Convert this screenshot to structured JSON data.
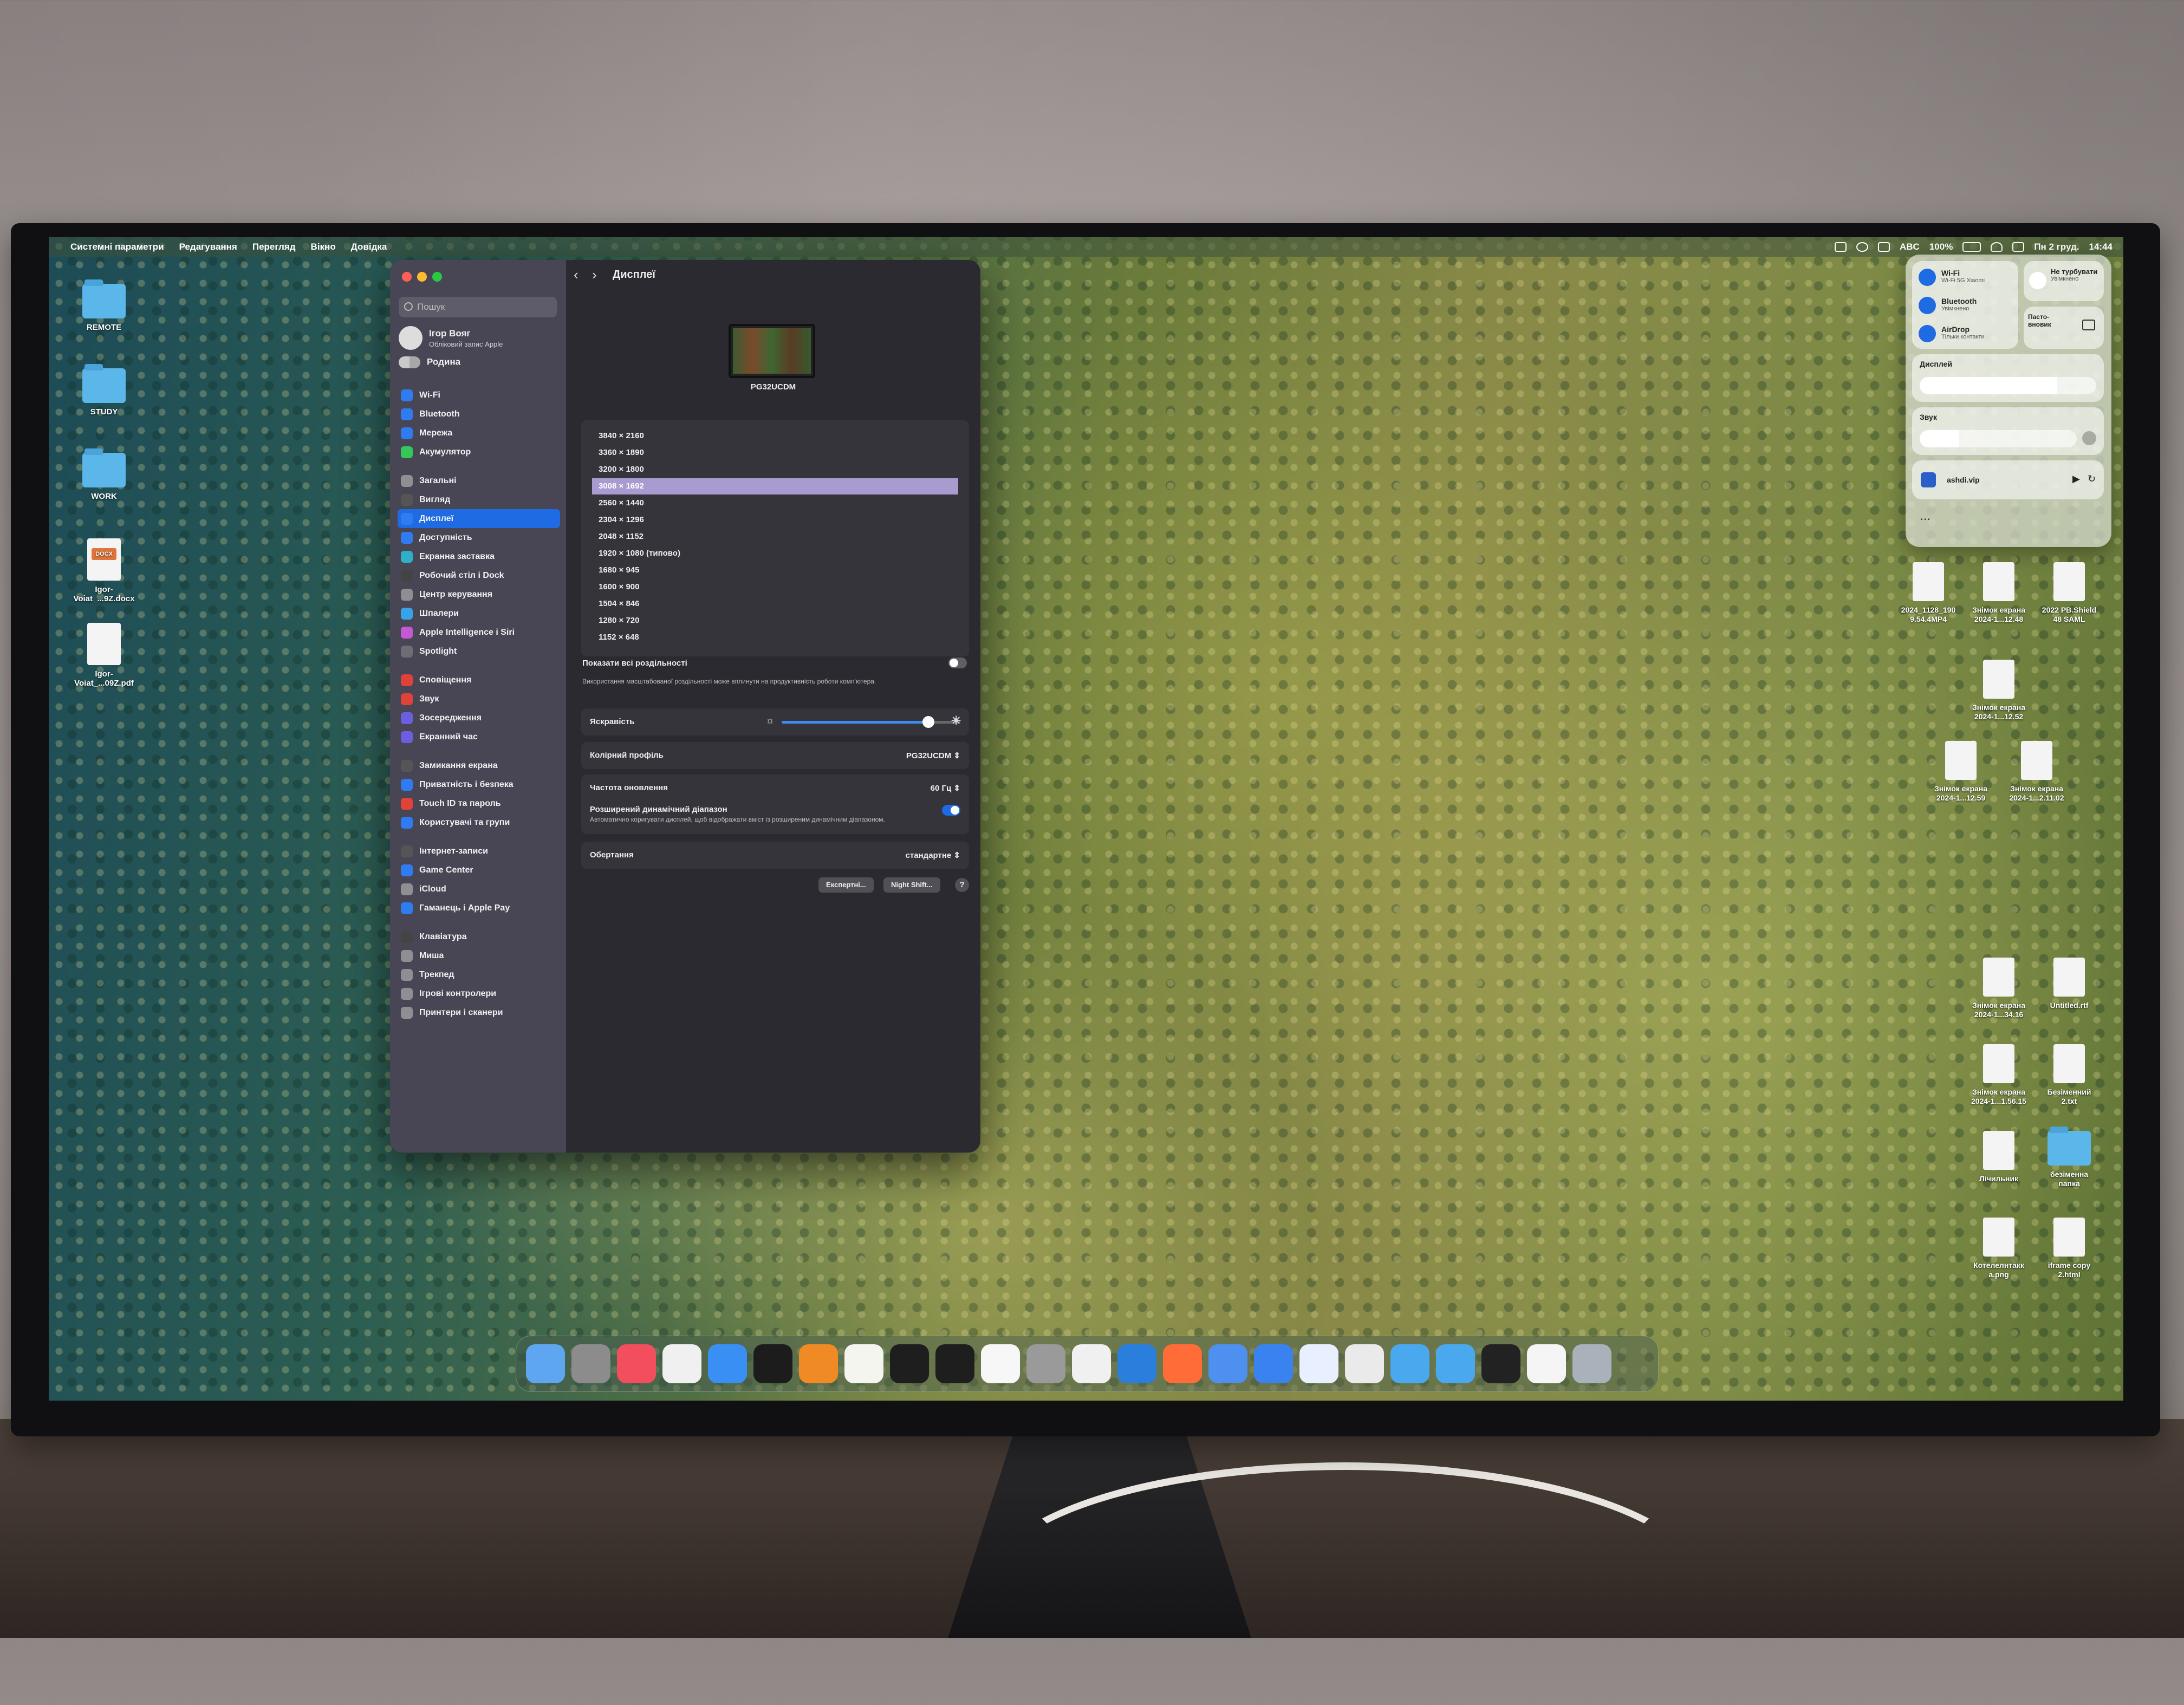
{
  "menubar": {
    "app_name": "Системні параметри",
    "menus": [
      "Редагування",
      "Перегляд",
      "Вікно",
      "Довідка"
    ],
    "right_labels": [
      "ABC",
      "100%",
      "Пн 2 груд.",
      "14:44"
    ]
  },
  "desktop_left": [
    {
      "label": "REMOTE",
      "kind": "folder"
    },
    {
      "label": "STUDY",
      "kind": "folder"
    },
    {
      "label": "WORK",
      "kind": "folder"
    },
    {
      "label": "Igor-Voiat_...9Z.docx",
      "kind": "doc",
      "badge": "DOCX"
    },
    {
      "label": "Igor-Voiat_...09Z.pdf",
      "kind": "doc",
      "badge": ""
    }
  ],
  "settings": {
    "search_placeholder": "Пошук",
    "profile_name": "Ігор Вояг",
    "profile_sub": "Обліковий запис Apple",
    "family": "Родина",
    "sidebar_groups": [
      [
        "Wi-Fi",
        "Bluetooth",
        "Мережа",
        "Акумулятор"
      ],
      [
        "Загальні",
        "Вигляд",
        "Дисплеї",
        "Доступність",
        "Екранна заставка",
        "Робочий стіл і Dock",
        "Центр керування",
        "Шпалери",
        "Apple Intelligence і Siri",
        "Spotlight"
      ],
      [
        "Сповіщення",
        "Звук",
        "Зосередження",
        "Екранний час"
      ],
      [
        "Замикання екрана",
        "Приватність і безпека",
        "Touch ID та пароль",
        "Користувачі та групи"
      ],
      [
        "Інтернет-записи",
        "Game Center",
        "iCloud",
        "Гаманець і Apple Pay"
      ],
      [
        "Клавіатура",
        "Миша",
        "Трекпед",
        "Ігрові контролери",
        "Принтери і сканери"
      ]
    ],
    "selected_item": "Дисплеї",
    "page_title": "Дисплеї",
    "monitor_name": "PG32UCDM",
    "resolutions": [
      "3840 × 2160",
      "3360 × 1890",
      "3200 × 1800",
      "3008 × 1692",
      "2560 × 1440",
      "2304 × 1296",
      "2048 × 1152",
      "1920 × 1080 (типово)",
      "1680 × 945",
      "1600 × 900",
      "1504 × 846",
      "1280 × 720",
      "1152 × 648"
    ],
    "selected_resolution": "3008 × 1692",
    "show_all_label": "Показати всі роздільності",
    "show_all_on": false,
    "scaled_note": "Використання масштабованої роздільності може вплинути на продуктивність роботи комп'ютера.",
    "brightness_label": "Яскравість",
    "brightness_level": 0.82,
    "color_profile_label": "Колірний профіль",
    "color_profile_value": "PG32UCDM",
    "refresh_label": "Частота оновлення",
    "refresh_value": "60 Гц",
    "hdr_label": "Розширений динамічний діапазон",
    "hdr_note": "Автоматично коригувати дисплей, щоб відображати вміст із розширеним динамічним діапазоном.",
    "hdr_on": true,
    "rotation_label": "Обертання",
    "rotation_value": "стандартне",
    "advanced_button": "Експертні...",
    "night_shift_button": "Night Shift...",
    "help": "?"
  },
  "control_center": {
    "wifi_title": "Wi-Fi",
    "wifi_sub": "Wi-Fi 5G Xiaomi",
    "bt_title": "Bluetooth",
    "bt_sub": "Увімкнено",
    "airdrop_title": "AirDrop",
    "airdrop_sub": "Тільки контакти",
    "dnd_title": "Не турбувати",
    "dnd_sub": "Увімкнено",
    "mirror_title": "Пасто-вновик",
    "display_label": "Дисплей",
    "display_level": 0.78,
    "sound_label": "Звук",
    "sound_level": 0.25,
    "now_playing": "ashdi.vip"
  },
  "desktop_right": [
    {
      "label": "2024_1128_190\n9.54.4MP4"
    },
    {
      "label": "Знімок екрана\n2024-1...12.48"
    },
    {
      "label": "2022 PB.Shield\n48 SAML"
    },
    {
      "label": "Знімок екрана\n2024-1...12.52"
    },
    {
      "label": "Знімок екрана\n2024-1...12.59"
    },
    {
      "label": "Знімок екрана\n2024-1...2.11.02"
    },
    {
      "label": "Знімок екрана\n2024-1...34.16"
    },
    {
      "label": "Untitled.rtf"
    },
    {
      "label": "Знімок екрана\n2024-1...1.56.15"
    },
    {
      "label": "Безіменний\n2.txt"
    },
    {
      "label": "Лічильник"
    },
    {
      "label": "безіменна\nпапка"
    },
    {
      "label": "Котелелнтакк\na.png"
    },
    {
      "label": "iframe copy\n2.html"
    }
  ],
  "dock_apps": [
    "Finder",
    "Скриншот",
    "Music",
    "Launchpad",
    "Safari",
    "IntelliJ IDEA",
    "Книги",
    "TextEdit",
    "Термінал",
    "Моніторинг",
    "Photos",
    "Системні параметри",
    "Chrome",
    "Docker",
    "Postman",
    "Xcode",
    "Ігри",
    "Bluetooth",
    "Synchronize",
    "Folder",
    "Folder",
    "Terminal",
    "Archive",
    "Bin"
  ],
  "colors": {
    "accent": "#1e6be3",
    "selected_resolution_bg": "#a99bd0",
    "sidebar_bg": "#4a4856",
    "content_bg": "#2b2a31"
  }
}
